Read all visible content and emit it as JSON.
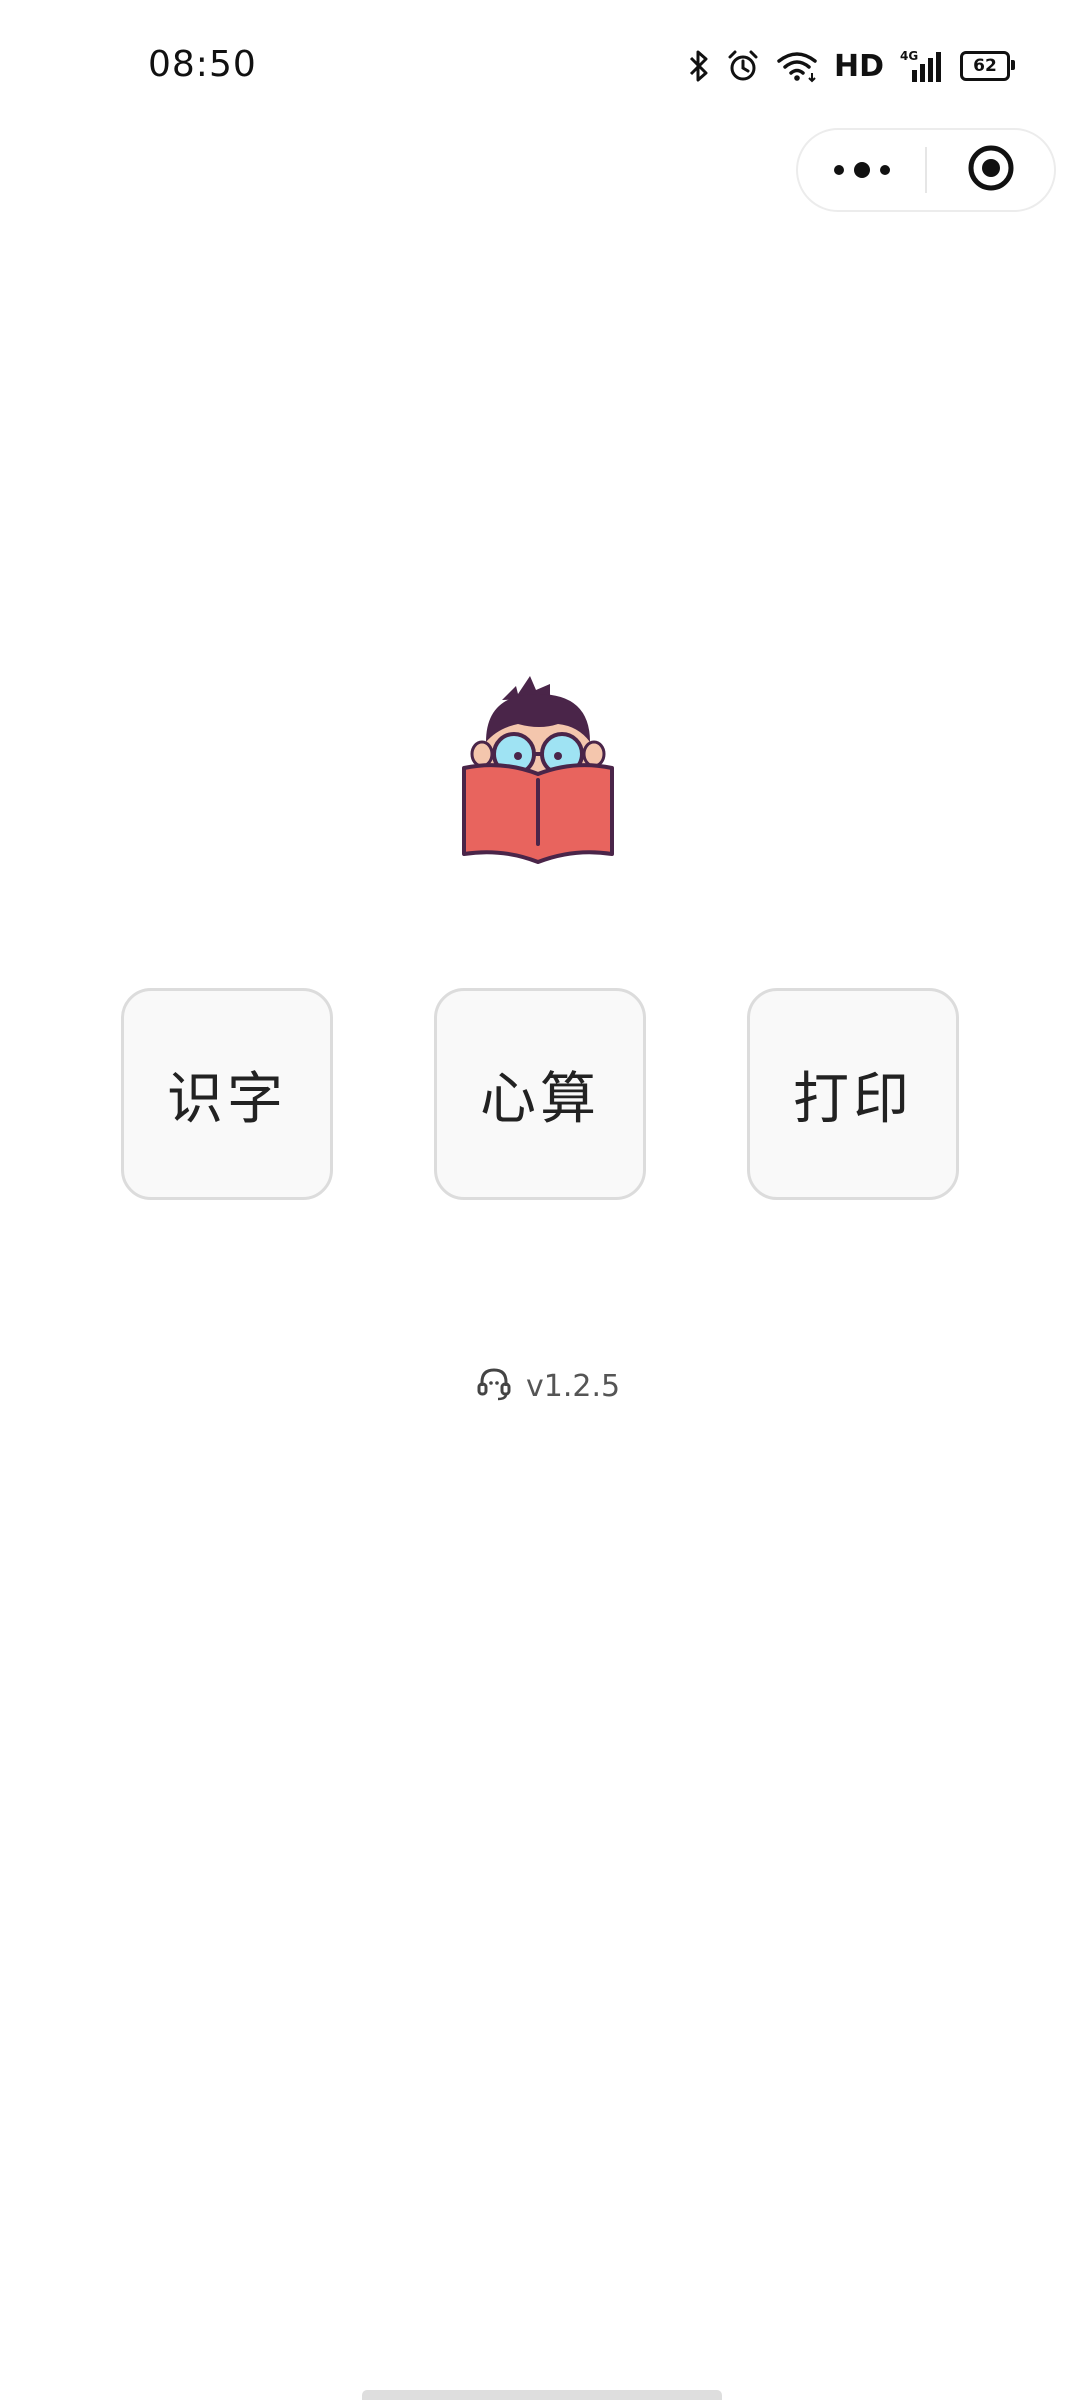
{
  "status_bar": {
    "time": "08:50",
    "icons": [
      "bluetooth-icon",
      "alarm-icon",
      "wifi-icon",
      "hd-indicator",
      "signal-4g-icon",
      "battery-icon"
    ],
    "hd_label": "HD",
    "network_label": "4G",
    "battery_level": "62"
  },
  "capsule": {
    "icons": [
      "more-options-icon",
      "close-target-icon"
    ]
  },
  "mascot": {
    "icon": "reading-kid-mascot"
  },
  "menu": {
    "items": [
      {
        "label": "识字"
      },
      {
        "label": "心算"
      },
      {
        "label": "打印"
      }
    ]
  },
  "footer": {
    "icon": "headset-support-icon",
    "version": "v1.2.5"
  },
  "colors": {
    "button_bg": "#f9f9f9",
    "button_border": "#dcdcdc",
    "book_red": "#e8645e",
    "glasses_blue": "#9fe3f3",
    "hair_purple": "#4a2549"
  }
}
